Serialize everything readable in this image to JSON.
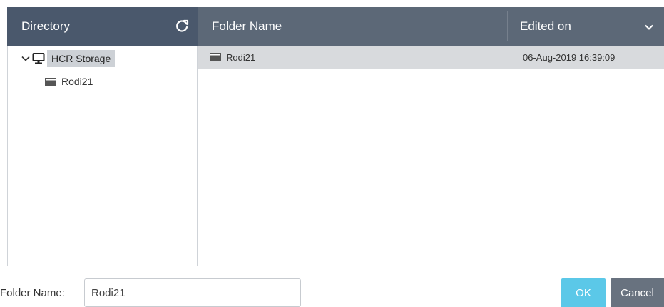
{
  "tree": {
    "header": "Directory",
    "refresh_icon": "refresh-icon",
    "root": {
      "label": "HCR Storage",
      "icon": "monitor-icon",
      "expanded": true
    },
    "children": [
      {
        "label": "Rodi21",
        "icon": "folder-icon"
      }
    ]
  },
  "list": {
    "columns": {
      "name": "Folder Name",
      "edited": "Edited on"
    },
    "rows": [
      {
        "name": "Rodi21",
        "edited": "06-Aug-2019 16:39:09"
      }
    ]
  },
  "footer": {
    "folder_name_label": "Folder Name:",
    "folder_name_value": "Rodi21",
    "ok_label": "OK",
    "cancel_label": "Cancel"
  },
  "colors": {
    "tree_header_bg": "#4a586c",
    "list_header_bg": "#5c6877",
    "selected_bg": "#d8dadd",
    "ok_button": "#5bc8e8",
    "cancel_button": "#68727f"
  }
}
